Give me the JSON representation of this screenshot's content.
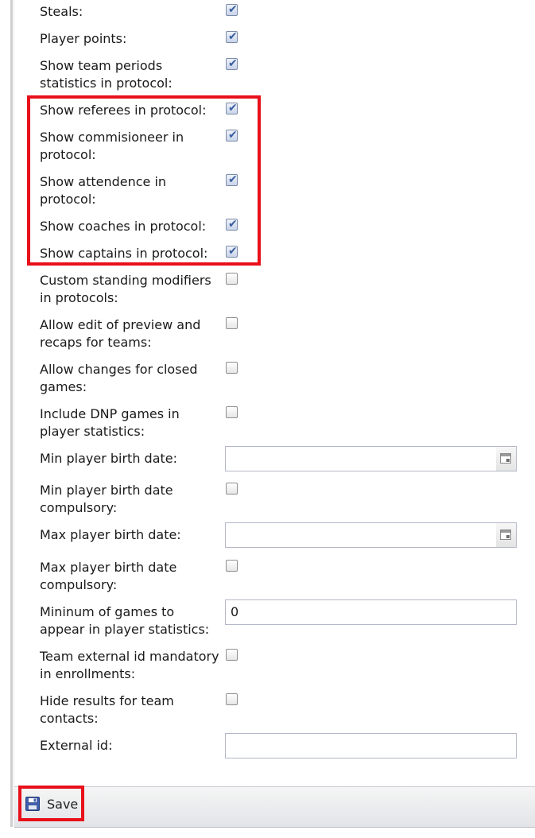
{
  "settings": [
    {
      "label": "Steals:",
      "type": "checkbox",
      "checked": true
    },
    {
      "label": "Player points:",
      "type": "checkbox",
      "checked": true
    },
    {
      "label": "Show team periods statistics in protocol:",
      "type": "checkbox",
      "checked": true
    },
    {
      "label": "Show referees in protocol:",
      "type": "checkbox",
      "checked": true
    },
    {
      "label": "Show commisioneer in protocol:",
      "type": "checkbox",
      "checked": true
    },
    {
      "label": "Show attendence in protocol:",
      "type": "checkbox",
      "checked": true
    },
    {
      "label": "Show coaches in protocol:",
      "type": "checkbox",
      "checked": true
    },
    {
      "label": "Show captains in protocol:",
      "type": "checkbox",
      "checked": true
    },
    {
      "label": "Custom standing modifiers in protocols:",
      "type": "checkbox",
      "checked": false
    },
    {
      "label": "Allow edit of preview and recaps for teams:",
      "type": "checkbox",
      "checked": false
    },
    {
      "label": "Allow changes for closed games:",
      "type": "checkbox",
      "checked": false
    },
    {
      "label": "Include DNP games in player statistics:",
      "type": "checkbox",
      "checked": false
    },
    {
      "label": "Min player birth date:",
      "type": "date",
      "value": ""
    },
    {
      "label": "Min player birth date compulsory:",
      "type": "checkbox",
      "checked": false
    },
    {
      "label": "Max player birth date:",
      "type": "date",
      "value": ""
    },
    {
      "label": "Max player birth date compulsory:",
      "type": "checkbox",
      "checked": false
    },
    {
      "label": "Mininum of games to appear in player statistics:",
      "type": "text",
      "value": "0"
    },
    {
      "label": "Team external id mandatory in enrollments:",
      "type": "checkbox",
      "checked": false
    },
    {
      "label": "Hide results for team contacts:",
      "type": "checkbox",
      "checked": false
    },
    {
      "label": "External id:",
      "type": "text",
      "value": ""
    }
  ],
  "toolbar": {
    "save_label": "Save",
    "save_icon": "floppy-disk-icon"
  },
  "colors": {
    "highlight": "#e8101a",
    "checkbox_tick": "#3b5fa0",
    "toolbar_bg": "#e9ebee"
  }
}
